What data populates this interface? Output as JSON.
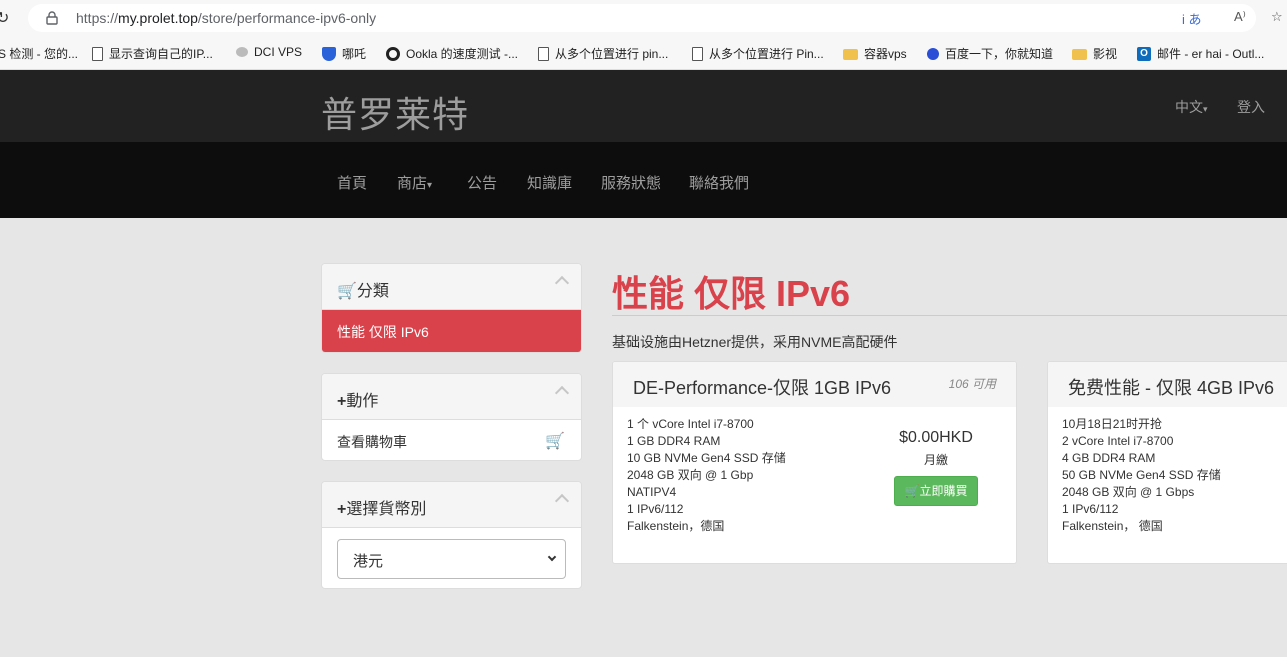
{
  "browser": {
    "url_host": "my.prolet.top",
    "url_prefix": "https://",
    "url_path": "/store/performance-ipv6-only",
    "bookmarks": [
      {
        "label": "S 检测 - 您的...",
        "icon": "cloud-icon"
      },
      {
        "label": "显示查询自己的IP...",
        "icon": "page-icon"
      },
      {
        "label": "DCI  VPS",
        "icon": "cloud-icon"
      },
      {
        "label": "哪吒",
        "icon": "shield-icon"
      },
      {
        "label": "Ookla 的速度测试 -...",
        "icon": "ookla-icon"
      },
      {
        "label": "从多个位置进行 pin...",
        "icon": "page-icon"
      },
      {
        "label": "从多个位置进行 Pin...",
        "icon": "page-icon"
      },
      {
        "label": "容器vps",
        "icon": "folder-icon"
      },
      {
        "label": "百度一下，你就知道",
        "icon": "baidu-paw-icon"
      },
      {
        "label": "影视",
        "icon": "folder-icon"
      },
      {
        "label": "邮件 - er hai - Outl...",
        "icon": "outlook-icon"
      }
    ]
  },
  "site": {
    "brand": "普罗莱特",
    "language": "中文",
    "login": "登入",
    "nav": [
      "首頁",
      "商店",
      "公告",
      "知識庫",
      "服務狀態",
      "聯絡我們"
    ]
  },
  "sidebar": {
    "categories_title": "分類",
    "active_category": "性能 仅限 IPv6",
    "actions_title": "動作",
    "view_cart": "查看購物車",
    "currency_title": "選擇貨幣別",
    "currency_value": "港元"
  },
  "main": {
    "title": "性能 仅限 IPv6",
    "tagline": "基础设施由Hetzner提供，采用NVME高配硬件",
    "products": [
      {
        "name": "DE-Performance-仅限 1GB IPv6",
        "qty": "106 可用",
        "features": [
          "1 个 vCore Intel i7-8700",
          "1 GB DDR4 RAM",
          "10 GB NVMe Gen4 SSD 存储",
          "2048 GB 双向 @ 1 Gbp",
          "NATIPV4",
          "1 IPv6/112",
          "Falkenstein，德国"
        ],
        "price": "$0.00HKD",
        "cycle": "月繳",
        "buy": "立即購買"
      },
      {
        "name": "免费性能 - 仅限 4GB IPv6",
        "features": [
          "10月18日21时开抢",
          "2 vCore Intel i7-8700",
          "4 GB DDR4 RAM",
          "50 GB NVMe Gen4 SSD 存储",
          "2048 GB 双向 @ 1 Gbps",
          "1 IPv6/112",
          "Falkenstein， 德国"
        ]
      }
    ]
  },
  "colors": {
    "accent": "#d9414b",
    "buy_button": "#5cb85c",
    "header_bg": "#222222"
  }
}
